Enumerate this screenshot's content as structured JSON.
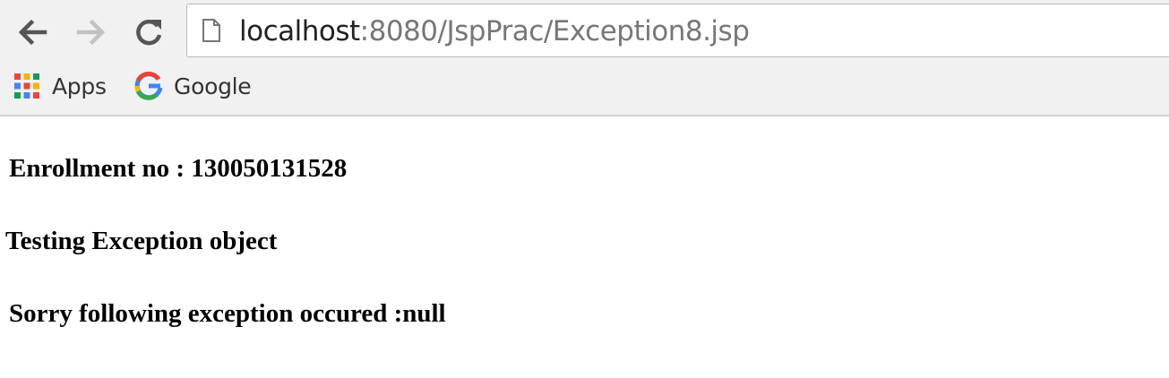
{
  "browser": {
    "address_bar": {
      "url_host": "localhost",
      "url_rest": ":8080/JspPrac/Exception8.jsp"
    },
    "icons": {
      "back": "arrow-left-icon",
      "forward": "arrow-right-icon",
      "reload": "reload-icon",
      "page": "page-icon"
    },
    "bookmarks": [
      {
        "label": "Apps",
        "icon": "apps-grid-icon"
      },
      {
        "label": "Google",
        "icon": "google-g-icon"
      }
    ]
  },
  "page": {
    "lines": [
      "Enrollment no : 130050131528",
      "Testing Exception object",
      "Sorry following exception occured :null"
    ]
  }
}
